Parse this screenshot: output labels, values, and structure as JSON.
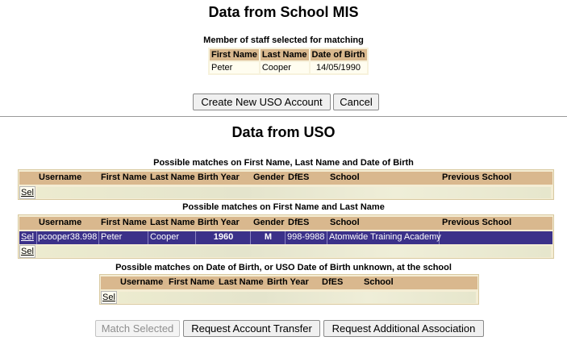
{
  "mis": {
    "title": "Data from School MIS",
    "caption": "Member of staff selected for matching",
    "headers": [
      "First Name",
      "Last Name",
      "Date of Birth"
    ],
    "row": [
      "Peter",
      "Cooper",
      "14/05/1990"
    ]
  },
  "actions_top": {
    "create": "Create New USO Account",
    "cancel": "Cancel"
  },
  "uso": {
    "title": "Data from USO",
    "section1": {
      "caption": "Possible matches on First Name, Last Name and Date of Birth",
      "headers": [
        "Username",
        "First Name",
        "Last Name",
        "Birth Year",
        "Gender",
        "DfES",
        "School",
        "Previous School"
      ],
      "sel": "Sel"
    },
    "section2": {
      "caption": "Possible matches on First Name and Last Name",
      "headers": [
        "Username",
        "First Name",
        "Last Name",
        "Birth Year",
        "Gender",
        "DfES",
        "School",
        "Previous School"
      ],
      "sel": "Sel",
      "row": {
        "username": "pcooper38.998",
        "first": "Peter",
        "last": "Cooper",
        "year": "1960",
        "gender": "M",
        "dfes": "998-9988",
        "school": "Atomwide Training Academy",
        "previous": ""
      }
    },
    "section3": {
      "caption": "Possible matches on Date of Birth, or USO Date of Birth unknown, at the school",
      "headers": [
        "Username",
        "First Name",
        "Last Name",
        "Birth Year",
        "DfES",
        "School"
      ],
      "sel": "Sel"
    }
  },
  "actions_bottom": {
    "match": "Match Selected",
    "transfer": "Request Account Transfer",
    "association": "Request Additional Association"
  }
}
